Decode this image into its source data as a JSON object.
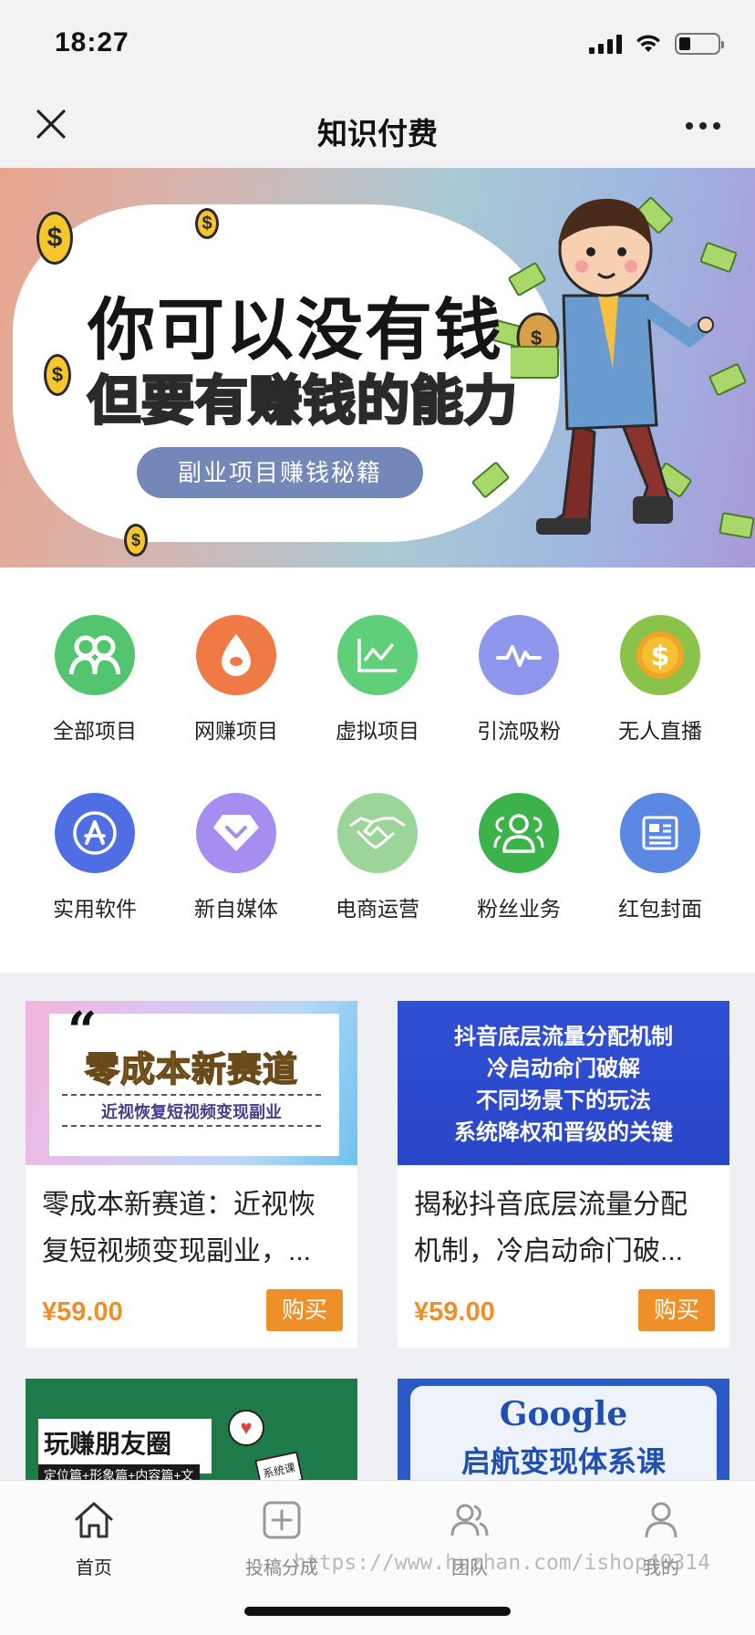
{
  "status_bar": {
    "time": "18:27"
  },
  "nav": {
    "title": "知识付费"
  },
  "banner": {
    "line1": "你可以没有钱",
    "line2": "但要有赚钱的能力",
    "pill": "副业项目赚钱秘籍"
  },
  "categories": [
    {
      "label": "全部项目",
      "icon": "people-icon",
      "color": "#53c56f"
    },
    {
      "label": "网赚项目",
      "icon": "drop-icon",
      "color": "#f07a45"
    },
    {
      "label": "虚拟项目",
      "icon": "line-chart-icon",
      "color": "#5fcf79"
    },
    {
      "label": "引流吸粉",
      "icon": "pulse-icon",
      "color": "#8f97ec"
    },
    {
      "label": "无人直播",
      "icon": "dollar-coin-icon",
      "color": "#8bc34a"
    },
    {
      "label": "实用软件",
      "icon": "app-store-icon",
      "color": "#4f6ee3"
    },
    {
      "label": "新自媒体",
      "icon": "diamond-icon",
      "color": "#a68ef0"
    },
    {
      "label": "电商运营",
      "icon": "handshake-icon",
      "color": "#9cd59a"
    },
    {
      "label": "粉丝业务",
      "icon": "group-icon",
      "color": "#3bb34a"
    },
    {
      "label": "红包封面",
      "icon": "document-icon",
      "color": "#5b88e3"
    }
  ],
  "products": [
    {
      "image": {
        "title": "零成本新赛道",
        "subtitle": "近视恢复短视频变现副业"
      },
      "title": "零成本新赛道：近视恢复短视频变现副业，...",
      "price": "¥59.00",
      "buy": "购买"
    },
    {
      "image": {
        "lines": [
          "抖音底层流量分配机制",
          "冷启动命门破解",
          "不同场景下的玩法",
          "系统降权和晋级的关键"
        ]
      },
      "title": "揭秘抖音底层流量分配机制，冷启动命门破...",
      "price": "¥59.00",
      "buy": "购买"
    },
    {
      "image": {
        "title": "玩赚朋友圈",
        "subtitle": "定位篇+形象篇+内容篇+文",
        "badge": "系统课"
      }
    },
    {
      "image": {
        "title": "Google",
        "subtitle": "启航变现体系课"
      }
    }
  ],
  "tabs": [
    {
      "label": "首页",
      "icon": "home-icon",
      "active": true
    },
    {
      "label": "投稿分成",
      "icon": "plus-square-icon",
      "active": false
    },
    {
      "label": "团队",
      "icon": "team-icon",
      "active": false
    },
    {
      "label": "我的",
      "icon": "user-icon",
      "active": false
    }
  ],
  "watermark": "https://www.huzhan.com/ishop40314"
}
